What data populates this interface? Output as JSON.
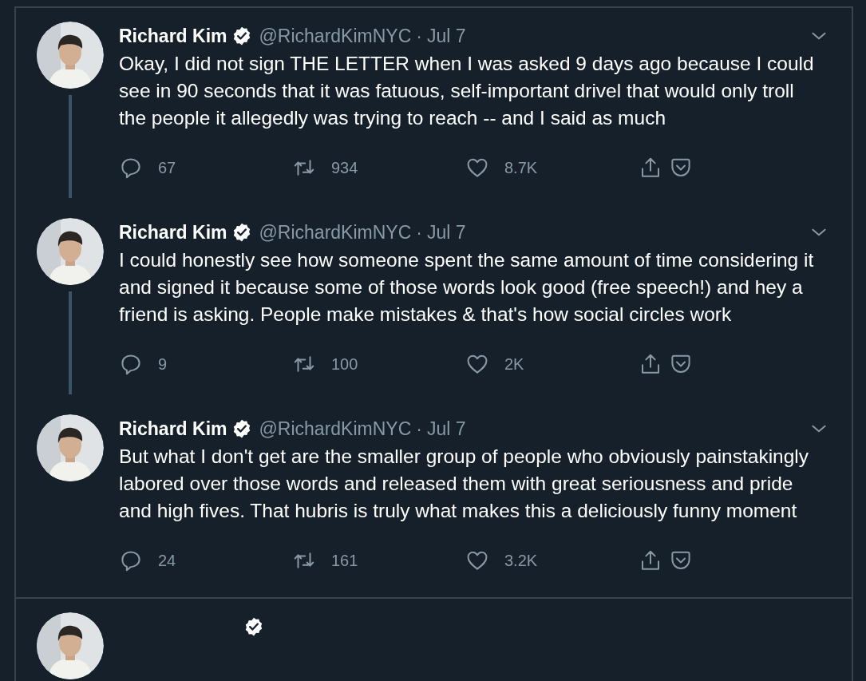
{
  "tweets": [
    {
      "name": "Richard Kim",
      "verified": true,
      "handle": "@RichardKimNYC",
      "separator": "·",
      "date": "Jul 7",
      "text": "Okay, I did not sign THE LETTER when I was asked 9 days ago because I could see in 90 seconds that it was fatuous, self-important drivel that would only troll the people it allegedly was trying to reach -- and I said as much",
      "replies": "67",
      "retweets": "934",
      "likes": "8.7K",
      "thread_continues": true
    },
    {
      "name": "Richard Kim",
      "verified": true,
      "handle": "@RichardKimNYC",
      "separator": "·",
      "date": "Jul 7",
      "text": "I could honestly see how someone spent the same amount of time considering it and signed it because some of those words look good (free speech!) and hey a friend is asking. People make mistakes & that's how social circles work",
      "replies": "9",
      "retweets": "100",
      "likes": "2K",
      "thread_continues": true
    },
    {
      "name": "Richard Kim",
      "verified": true,
      "handle": "@RichardKimNYC",
      "separator": "·",
      "date": "Jul 7",
      "text": "But what I don't get are the smaller group of people who obviously painstakingly labored over those words and released them with great seriousness and pride and high fives. That hubris is truly what makes this a deliciously funny moment",
      "replies": "24",
      "retweets": "161",
      "likes": "3.2K",
      "thread_continues": false
    }
  ],
  "partial_tweet": {
    "verified": true
  }
}
